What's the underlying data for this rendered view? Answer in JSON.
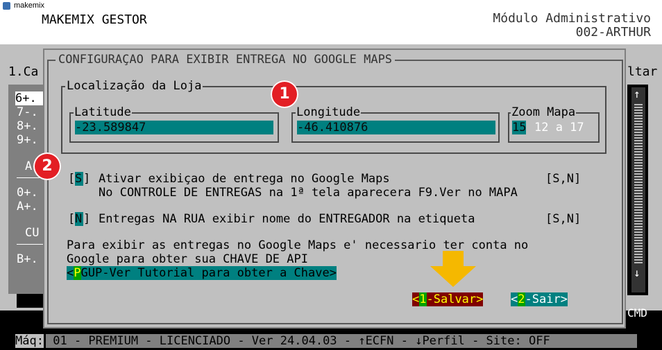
{
  "window": {
    "title": "makemix",
    "icon": "makemix-app-icon"
  },
  "header": {
    "app_name": "MAKEMIX GESTOR",
    "module": "Módulo Administrativo",
    "user": "002-ARTHUR"
  },
  "background_menu": {
    "top_left": "1.Ca",
    "top_right": "ltar",
    "items": [
      "6+.",
      "7-.",
      "8+.",
      "9+.",
      "A",
      "0+.",
      "A+.",
      "CU",
      "B+."
    ],
    "right_label": "CMD"
  },
  "dialog": {
    "title": "CONFIGURAÇAO PARA EXIBIR ENTREGA NO GOOGLE MAPS",
    "location_group": "Localização da Loja",
    "latitude": {
      "label": "Latitude",
      "value": "-23.589847"
    },
    "longitude": {
      "label": "Longitude",
      "value": "-46.410876"
    },
    "zoom": {
      "label": "Zoom Mapa",
      "value": "15",
      "range": "12 a 17"
    },
    "option1": {
      "value": "S",
      "label": "Ativar exibiçao de entrega no Google Maps",
      "choices": "[S,N]",
      "note": "No CONTROLE DE ENTREGAS na 1ª tela aparecera F9.Ver no MAPA"
    },
    "option2": {
      "value": "N",
      "label": "Entregas NA RUA exibir nome do ENTREGADOR na etiqueta",
      "choices": "[S,N]"
    },
    "info_line1": "Para exibir as entregas no Google Maps e' necessario ter conta no",
    "info_line2": "Google para obter sua CHAVE DE API",
    "tutorial": {
      "pre": "<",
      "key": "P",
      "text": "GUP-Ver Tutorial para obter a Chave>"
    },
    "save": {
      "pre": "<",
      "key": "1",
      "text": "-Salvar>"
    },
    "exit": {
      "pre": "<",
      "key": "2",
      "text": "-Sair>"
    }
  },
  "annotations": {
    "badge1": "1",
    "badge2": "2"
  },
  "status_bar": {
    "label": "Máq:",
    "text": " 01 - PREMIUM - LICENCIADO - Ver 24.04.03 - ↑ECFN - ↓Perfil - Site: OFF"
  },
  "colors": {
    "field_bg": "#008080",
    "dialog_bg": "#c0c0c0",
    "save_bg": "#800000",
    "save_fg": "#ffff00",
    "hotkey_bg": "#00a000",
    "annotation_red": "#e31e24",
    "arrow": "#f5b800"
  }
}
